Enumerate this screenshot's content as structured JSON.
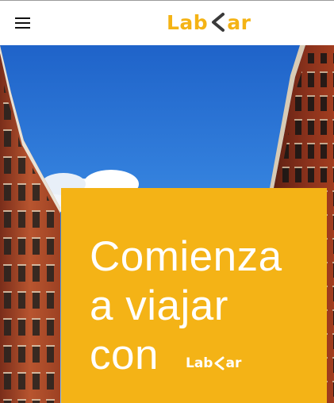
{
  "header": {
    "menu_icon": "hamburger-menu-icon",
    "logo": {
      "prefix": "Lab",
      "suffix": "ar",
      "mark_icon": "chevron-left-icon",
      "color": "#f4b315"
    }
  },
  "hero": {
    "background": "city-buildings-blue-sky-photo",
    "card_color": "#f4b316",
    "headline_lines": [
      "Comienza",
      "a viajar",
      "con"
    ],
    "card_logo": {
      "prefix": "Lab",
      "suffix": "ar",
      "color": "#ffffff"
    }
  }
}
